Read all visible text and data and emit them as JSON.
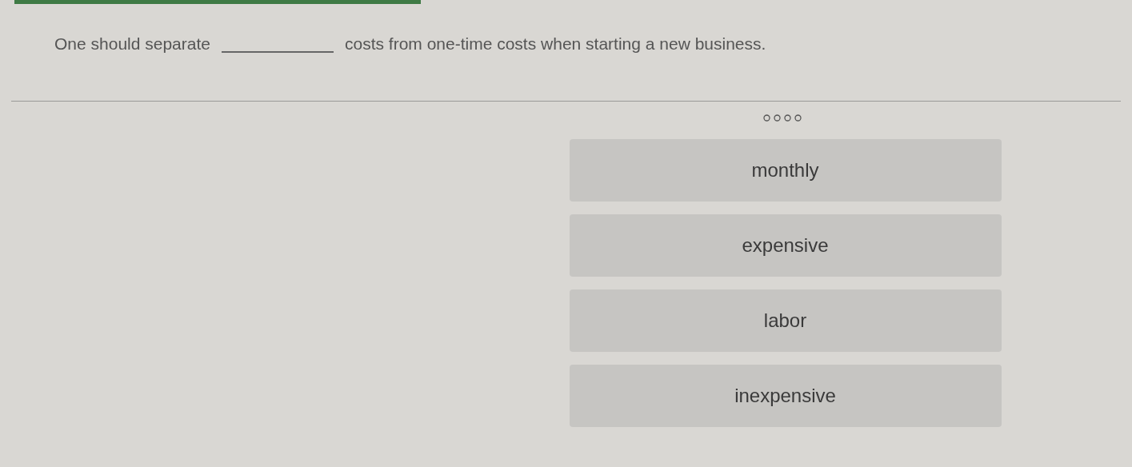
{
  "question": {
    "before": "One should separate",
    "after": "costs from one-time costs when starting a new business."
  },
  "options": [
    {
      "label": "monthly"
    },
    {
      "label": "expensive"
    },
    {
      "label": "labor"
    },
    {
      "label": "inexpensive"
    }
  ]
}
